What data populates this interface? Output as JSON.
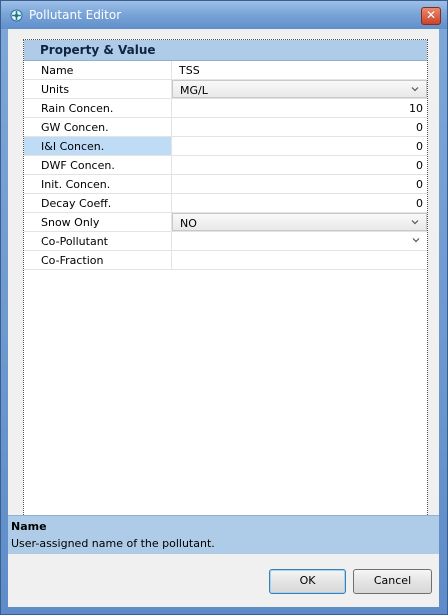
{
  "window": {
    "title": "Pollutant Editor",
    "close_glyph": "✕"
  },
  "grid": {
    "header": "Property  &  Value",
    "rows": [
      {
        "name": "Name",
        "value": "TSS",
        "align": "left",
        "kind": "text"
      },
      {
        "name": "Units",
        "value": "MG/L",
        "align": "left",
        "kind": "dropdown"
      },
      {
        "name": "Rain Concen.",
        "value": "10",
        "align": "right",
        "kind": "text"
      },
      {
        "name": "GW Concen.",
        "value": "0",
        "align": "right",
        "kind": "text"
      },
      {
        "name": "I&I Concen.",
        "value": "0",
        "align": "right",
        "kind": "text",
        "selected": true
      },
      {
        "name": "DWF Concen.",
        "value": "0",
        "align": "right",
        "kind": "text"
      },
      {
        "name": "Init. Concen.",
        "value": "0",
        "align": "right",
        "kind": "text"
      },
      {
        "name": "Decay Coeff.",
        "value": "0",
        "align": "right",
        "kind": "text"
      },
      {
        "name": "Snow Only",
        "value": "NO",
        "align": "left",
        "kind": "dropdown"
      },
      {
        "name": "Co-Pollutant",
        "value": "",
        "align": "left",
        "kind": "dropdown-plain"
      },
      {
        "name": "Co-Fraction",
        "value": "",
        "align": "left",
        "kind": "text"
      }
    ]
  },
  "description": {
    "title": "Name",
    "text": "User-assigned name of the pollutant."
  },
  "buttons": {
    "ok": "OK",
    "cancel": "Cancel"
  },
  "icons": {
    "app": "pollutant-app-icon",
    "close": "close-icon",
    "dropdown": "chevron-down-icon"
  }
}
